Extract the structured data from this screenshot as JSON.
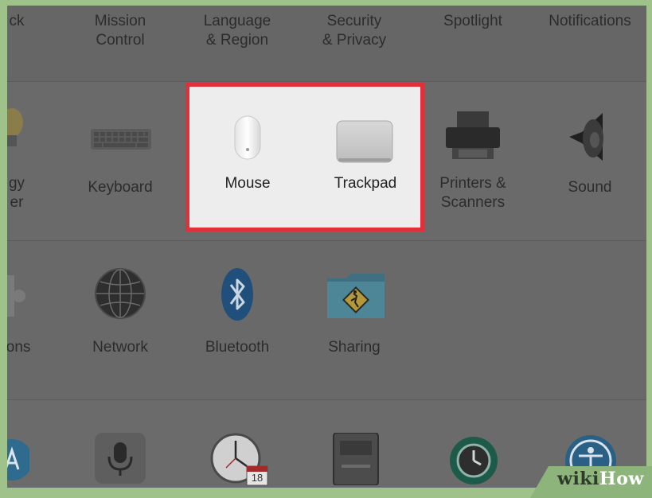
{
  "row1": [
    {
      "name": "partial-dock",
      "label": "ck"
    },
    {
      "name": "mission-control",
      "label": "Mission\nControl"
    },
    {
      "name": "language-region",
      "label": "Language\n& Region"
    },
    {
      "name": "security-privacy",
      "label": "Security\n& Privacy"
    },
    {
      "name": "spotlight",
      "label": "Spotlight"
    },
    {
      "name": "notifications",
      "label": "Notifications"
    }
  ],
  "row2": [
    {
      "name": "partial-energy-saver",
      "label": "gy\ner"
    },
    {
      "name": "keyboard",
      "label": "Keyboard"
    },
    {
      "name": "mouse",
      "label": "Mouse"
    },
    {
      "name": "trackpad",
      "label": "Trackpad"
    },
    {
      "name": "printers-scanners",
      "label": "Printers &\nScanners"
    },
    {
      "name": "sound",
      "label": "Sound"
    }
  ],
  "row3": [
    {
      "name": "partial-extensions",
      "label": "ions"
    },
    {
      "name": "network",
      "label": "Network"
    },
    {
      "name": "bluetooth",
      "label": "Bluetooth"
    },
    {
      "name": "sharing",
      "label": "Sharing"
    }
  ],
  "row4": {
    "calendar_day": "18"
  },
  "watermark": {
    "wiki": "wiki",
    "how": "How"
  },
  "colors": {
    "highlight_border": "#e0303b",
    "highlight_bg": "#ededed",
    "dimmed_bg": "#666666"
  }
}
